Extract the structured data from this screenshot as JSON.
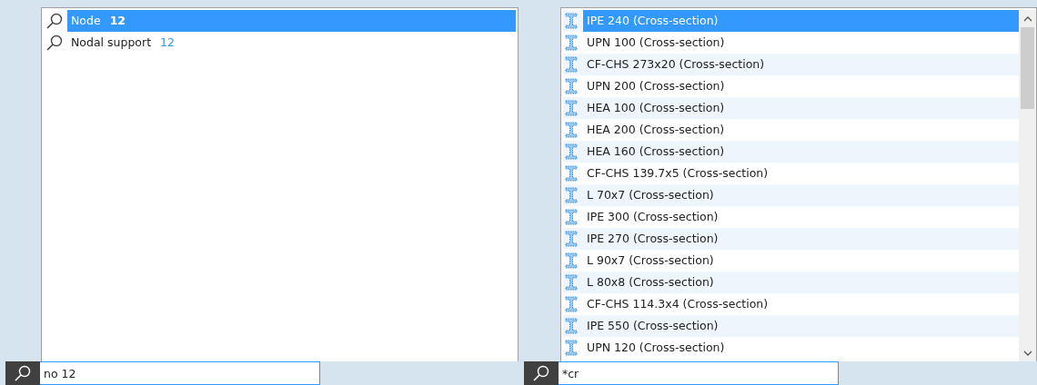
{
  "left_panel": {
    "results": [
      {
        "name": "Node",
        "count": "12",
        "selected": true
      },
      {
        "name": "Nodal support",
        "count": "12",
        "selected": false
      }
    ],
    "search": {
      "value": "no 12"
    }
  },
  "right_panel": {
    "results": [
      {
        "name": "IPE 240 (Cross-section)",
        "selected": true
      },
      {
        "name": "UPN 100 (Cross-section)",
        "selected": false
      },
      {
        "name": "CF-CHS 273x20 (Cross-section)",
        "selected": false
      },
      {
        "name": "UPN 200 (Cross-section)",
        "selected": false
      },
      {
        "name": "HEA 100 (Cross-section)",
        "selected": false
      },
      {
        "name": "HEA 200 (Cross-section)",
        "selected": false
      },
      {
        "name": "HEA 160 (Cross-section)",
        "selected": false
      },
      {
        "name": "CF-CHS 139.7x5 (Cross-section)",
        "selected": false
      },
      {
        "name": "L 70x7 (Cross-section)",
        "selected": false
      },
      {
        "name": "IPE 300 (Cross-section)",
        "selected": false
      },
      {
        "name": "IPE 270 (Cross-section)",
        "selected": false
      },
      {
        "name": "L 90x7 (Cross-section)",
        "selected": false
      },
      {
        "name": "L 80x8 (Cross-section)",
        "selected": false
      },
      {
        "name": "CF-CHS 114.3x4 (Cross-section)",
        "selected": false
      },
      {
        "name": "IPE 550 (Cross-section)",
        "selected": false
      },
      {
        "name": "UPN 120 (Cross-section)",
        "selected": false
      }
    ],
    "search": {
      "value": "*cr"
    }
  }
}
